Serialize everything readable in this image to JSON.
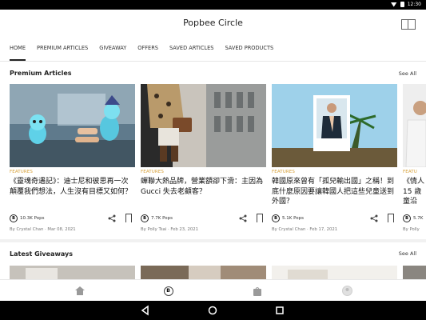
{
  "status": {
    "time": "12:30"
  },
  "app": {
    "title": "Popbee Circle"
  },
  "tabs": [
    "HOME",
    "PREMIUM ARTICLES",
    "GIVEAWAY",
    "OFFERS",
    "SAVED ARTICLES",
    "SAVED PRODUCTS"
  ],
  "premium": {
    "title": "Premium Articles",
    "see_all": "See All",
    "articles": [
      {
        "category": "FEATURES",
        "title": "《靈魂奇遇記》：迪士尼和彼思再一次顛覆我們想法，人生沒有目標又如何？",
        "pops": "10.3K Pops",
        "byline": "By Crystal Chan · Mar 08, 2021"
      },
      {
        "category": "FEATURES",
        "title": "蟬聯大熱品牌，營業額卻下滑：主因為 Gucci 失去老顧客？",
        "pops": "7.7K Pops",
        "byline": "By Polly Tsai · Feb 23, 2021"
      },
      {
        "category": "FEATURES",
        "title": "韓國原來曾有「孤兒輸出國」之稱！到底什麼原因要讓韓國人把這些兒童送到外國？",
        "pops": "5.1K Pops",
        "byline": "By Crystal Chan · Feb 17, 2021"
      },
      {
        "category": "FEATU",
        "title": "《情人15 歲童沿",
        "pops": "5.7K",
        "byline": "By Polly"
      }
    ]
  },
  "giveaways": {
    "title": "Latest Giveaways",
    "see_all": "See All"
  },
  "colors": {
    "accent": "#d7a03a"
  }
}
